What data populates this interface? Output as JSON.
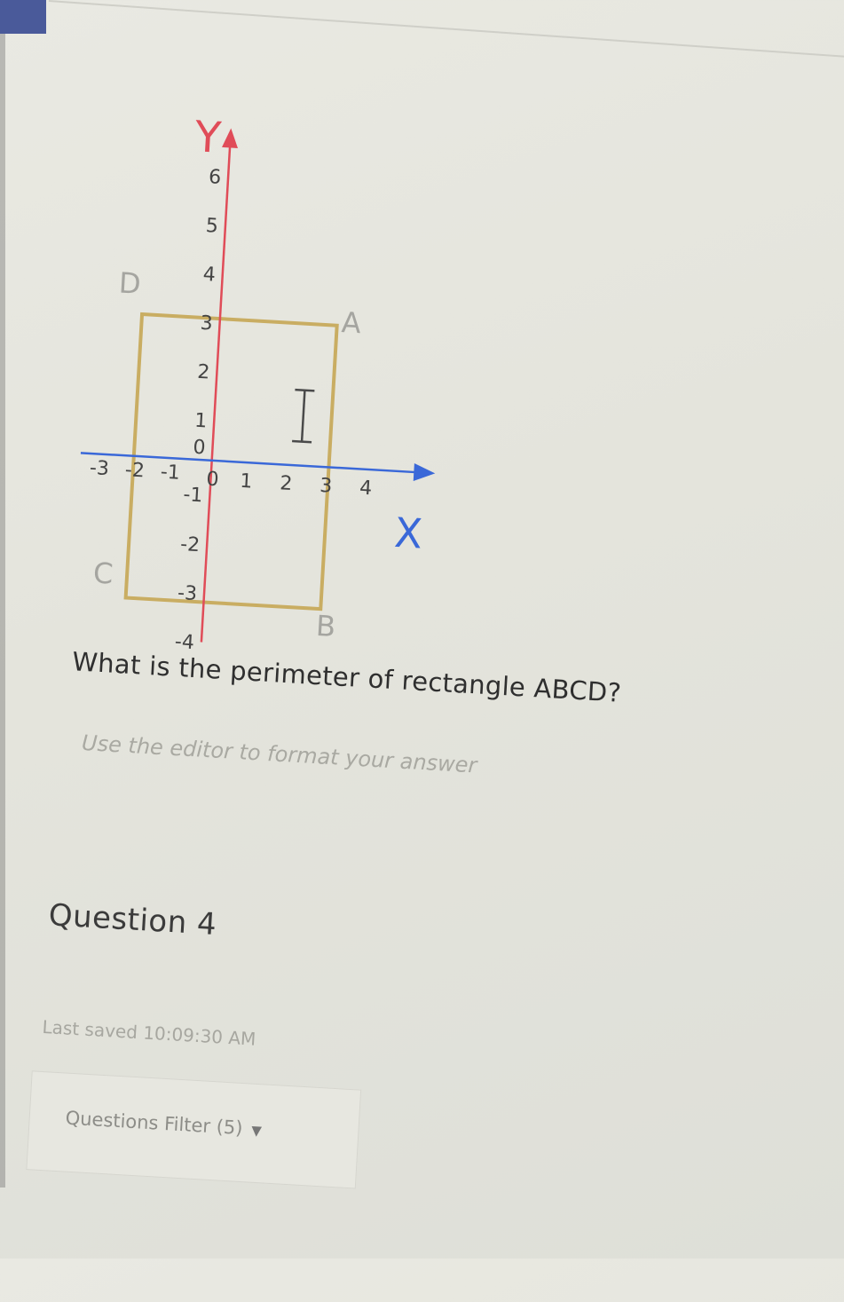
{
  "figure": {
    "x_axis_label": "X",
    "y_axis_label": "Y",
    "x_ticks": [
      "-3",
      "-2",
      "-1",
      "0",
      "1",
      "2",
      "3",
      "4"
    ],
    "y_ticks": [
      "6",
      "5",
      "4",
      "3",
      "2",
      "1",
      "0",
      "-1",
      "-2",
      "-3",
      "-4"
    ],
    "points": {
      "a": "A",
      "b": "B",
      "c": "C",
      "d": "D"
    },
    "colors": {
      "x_axis": "#3a68d8",
      "y_axis": "#e04c58",
      "rectangle": "#c9ad62"
    }
  },
  "question": {
    "text": "What is the perimeter of rectangle ABCD?",
    "hint": "Use the editor to format your answer"
  },
  "next_question": {
    "title": "Question 4",
    "last_saved": "Last saved 10:09:30 AM"
  },
  "filter": {
    "label": "Questions Filter (5)",
    "icon": "chevron-down-icon"
  }
}
